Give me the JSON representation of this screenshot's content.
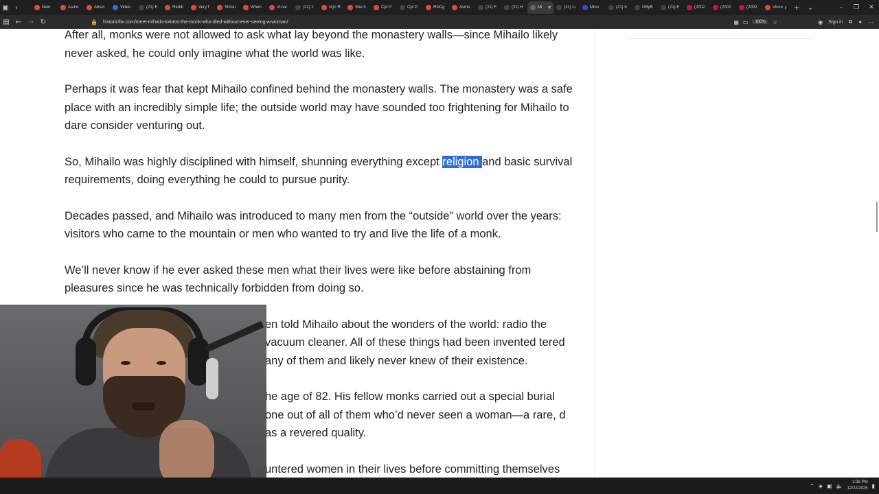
{
  "browser": {
    "tabs": [
      {
        "label": "New",
        "color": "#e04a3a",
        "active": false
      },
      {
        "label": "Asmo",
        "color": "#e04a3a",
        "active": false
      },
      {
        "label": "Absol",
        "color": "#e04a3a",
        "active": false
      },
      {
        "label": "Video",
        "color": "#2f6fd1",
        "active": false
      },
      {
        "label": "(21) E",
        "color": "#444444",
        "active": false
      },
      {
        "label": "Reddi",
        "color": "#e04a3a",
        "active": false
      },
      {
        "label": "Very f",
        "color": "#e04a3a",
        "active": false
      },
      {
        "label": "Shrou",
        "color": "#e04a3a",
        "active": false
      },
      {
        "label": "When",
        "color": "#e04a3a",
        "active": false
      },
      {
        "label": "r/Live",
        "color": "#e04a3a",
        "active": false
      },
      {
        "label": "(21) 2",
        "color": "#444444",
        "active": false
      },
      {
        "label": "xQc R",
        "color": "#e04a3a",
        "active": false
      },
      {
        "label": "She h",
        "color": "#e04a3a",
        "active": false
      },
      {
        "label": "Cpt P",
        "color": "#e04a3a",
        "active": false
      },
      {
        "label": "Cpt P",
        "color": "#444444",
        "active": false
      },
      {
        "label": "RDCg",
        "color": "#e04a3a",
        "active": false
      },
      {
        "label": "Asmo",
        "color": "#e04a3a",
        "active": false
      },
      {
        "label": "(21) F",
        "color": "#444444",
        "active": false
      },
      {
        "label": "(21) H",
        "color": "#444444",
        "active": false
      },
      {
        "label": "Mi",
        "color": "#666666",
        "active": true
      },
      {
        "label": "(21) Li",
        "color": "#444444",
        "active": false
      },
      {
        "label": "Minn",
        "color": "#2f4fd1",
        "active": false
      },
      {
        "label": "(21) h",
        "color": "#444444",
        "active": false
      },
      {
        "label": "GByB",
        "color": "#444444",
        "active": false
      },
      {
        "label": "(21) E",
        "color": "#444444",
        "active": false
      },
      {
        "label": "(2002",
        "color": "#d01040",
        "active": false
      },
      {
        "label": "(2002",
        "color": "#d01040",
        "active": false
      },
      {
        "label": "(2002",
        "color": "#d01040",
        "active": false
      },
      {
        "label": "Vince",
        "color": "#e04a3a",
        "active": false
      }
    ],
    "url": "historicflix.com/meet-mihailo-tolotos-the-monk-who-died-without-ever-seeing-a-woman/",
    "zoom": "180%",
    "signin_label": "Sign in"
  },
  "article": {
    "paragraphs": [
      {
        "text": "After all, monks were not allowed to ask what lay beyond the monastery walls—since Mihailo likely never asked, he could only imagine what the world was like."
      },
      {
        "text": "Perhaps it was fear that kept Mihailo confined behind the monastery walls. The monastery was a safe place with an incredibly simple life; the outside world may have sounded too frightening for Mihailo to dare consider venturing out."
      },
      {
        "before": "So, Mihailo was highly disciplined with himself, shunning everything except ",
        "highlight": "religion ",
        "after": "and basic survival requirements, doing everything he could to pursue purity."
      },
      {
        "text": "Decades passed, and Mihailo was introduced to many men from the “outside” world over the years: visitors who came to the mountain or men who wanted to try and live the life of a monk."
      },
      {
        "text": "We’ll never know if he ever asked these men what their lives were like before abstaining from pleasures since he was technically forbidden from doing so."
      },
      {
        "text": "en told Mihailo about the wonders of the world: radio the vacuum cleaner. All of these things had been invented tered any of them and likely never knew of their existence."
      },
      {
        "text": "he age of 82. His fellow monks carried out a special burial one out of all of them who’d never seen a woman—a rare, d as a revered quality."
      },
      {
        "text": "untered women in their lives before committing themselves"
      }
    ]
  },
  "taskbar": {
    "time": "3:38 PM",
    "date": "12/22/2025"
  }
}
